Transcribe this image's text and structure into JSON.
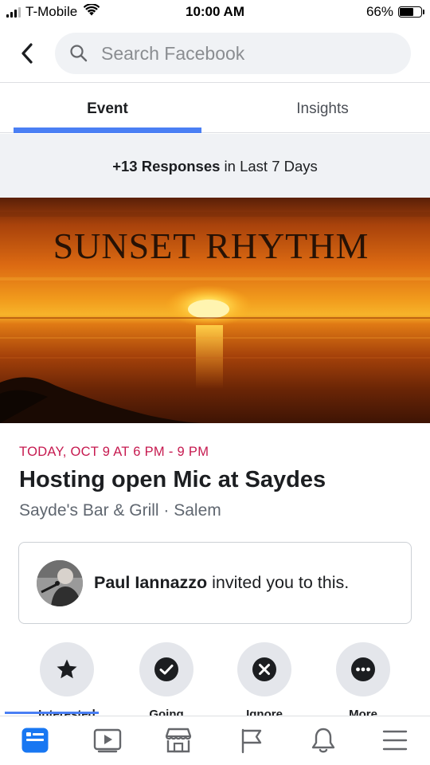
{
  "status_bar": {
    "carrier": "T-Mobile",
    "time": "10:00 AM",
    "battery": "66%",
    "battery_level": 0.66
  },
  "search": {
    "placeholder": "Search Facebook"
  },
  "tabs": [
    {
      "label": "Event",
      "active": true
    },
    {
      "label": "Insights",
      "active": false
    }
  ],
  "responses_banner": {
    "count": "+13 Responses",
    "suffix": " in Last 7 Days"
  },
  "cover": {
    "title": "SUNSET RHYTHM"
  },
  "event": {
    "date": "TODAY, OCT 9 AT 6 PM - 9 PM",
    "title": "Hosting open Mic at Saydes",
    "place": "Sayde's Bar & Grill · Salem"
  },
  "invite": {
    "name": "Paul Iannazzo",
    "text": " invited you to this."
  },
  "actions": [
    {
      "label": "Interested",
      "icon": "star-icon"
    },
    {
      "label": "Going",
      "icon": "check-icon"
    },
    {
      "label": "Ignore",
      "icon": "x-icon"
    },
    {
      "label": "More",
      "icon": "ellipsis-icon"
    }
  ],
  "bottom_nav": [
    {
      "icon": "news-feed-icon",
      "active": true
    },
    {
      "icon": "watch-icon",
      "active": false
    },
    {
      "icon": "marketplace-icon",
      "active": false
    },
    {
      "icon": "pages-flag-icon",
      "active": false
    },
    {
      "icon": "notifications-bell-icon",
      "active": false
    },
    {
      "icon": "menu-icon",
      "active": false
    }
  ],
  "colors": {
    "accent": "#4a7ff4",
    "date": "#c6194f",
    "light_bg": "#f0f2f5"
  }
}
